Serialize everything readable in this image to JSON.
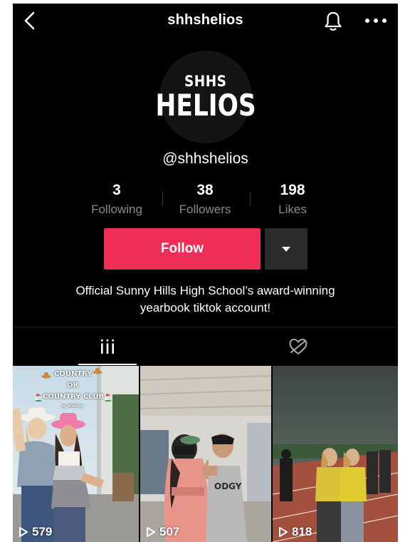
{
  "header": {
    "title": "shhshelios"
  },
  "profile": {
    "avatar_line1": "SHHS",
    "avatar_line2": "HELIOS",
    "handle": "@shhshelios"
  },
  "stats": [
    {
      "value": "3",
      "label": "Following"
    },
    {
      "value": "38",
      "label": "Followers"
    },
    {
      "value": "198",
      "label": "Likes"
    }
  ],
  "actions": {
    "follow_label": "Follow"
  },
  "bio": {
    "line1": "Official Sunny Hills High School’s award-winning",
    "line2": "yearbook tiktok account!"
  },
  "tabs": [
    {
      "icon": "grid-icon",
      "active": true
    },
    {
      "icon": "liked-heart-icon",
      "active": false
    }
  ],
  "videos": [
    {
      "views": "579",
      "caption_lines": [
        "COUNTRY",
        "OR",
        "COUNTRY CLUB",
        "w/ Helios"
      ]
    },
    {
      "views": "507"
    },
    {
      "views": "818"
    }
  ],
  "colors": {
    "background": "#000000",
    "follow_button": "#ee2e56",
    "secondary_button": "#2b2b2b",
    "muted_text": "#8a8a8a"
  }
}
